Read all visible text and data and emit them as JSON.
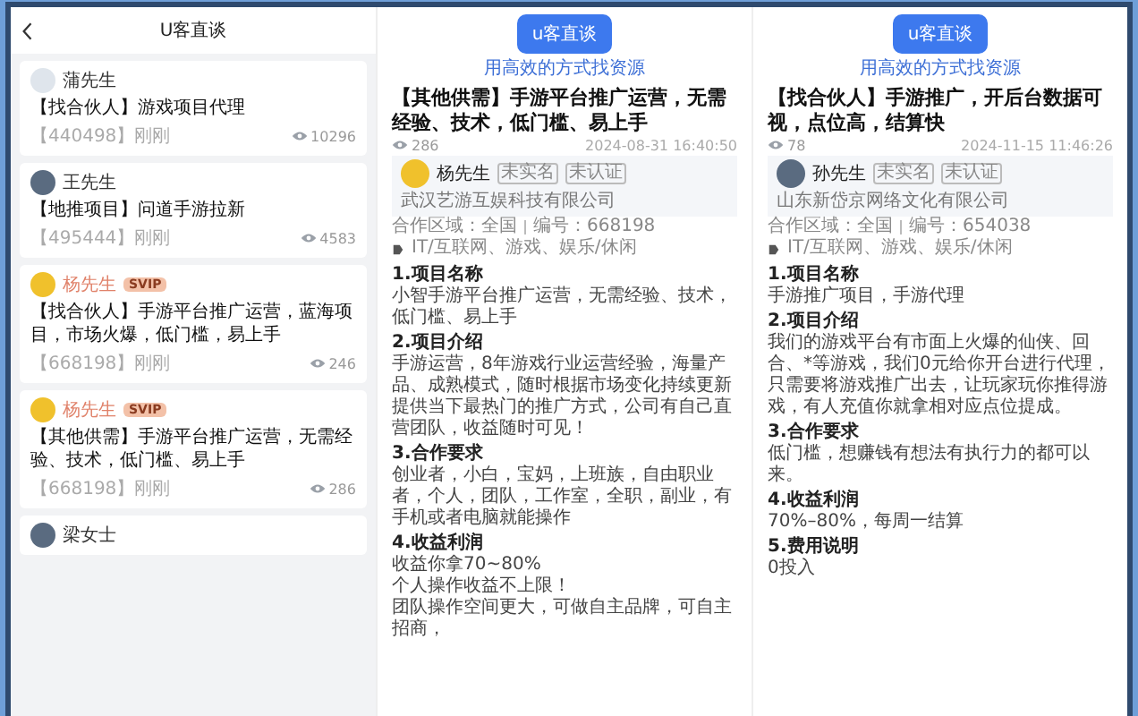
{
  "list_panel": {
    "title": "U客直谈",
    "items": [
      {
        "name": "蒲先生",
        "avatar": {
          "kind": "blank"
        },
        "title": "【找合伙人】游戏项目代理",
        "code": "【440498】刚刚",
        "views": "10296"
      },
      {
        "name": "王先生",
        "avatar": {
          "kind": "photo"
        },
        "title": "【地推项目】问道手游拉新",
        "code": "【495444】刚刚",
        "views": "4583"
      },
      {
        "name": "杨先生",
        "avatar": {
          "kind": "logo"
        },
        "badge": "SVIP",
        "title": "【找合伙人】手游平台推广运营，蓝海项目，市场火爆，低门槛，易上手",
        "code": "【668198】刚刚",
        "views": "246"
      },
      {
        "name": "杨先生",
        "avatar": {
          "kind": "logo"
        },
        "badge": "SVIP",
        "title": "【其他供需】手游平台推广运营，无需经验、技术，低门槛、易上手",
        "code": "【668198】刚刚",
        "views": "286"
      },
      {
        "name": "梁女士",
        "avatar": {
          "kind": "photo"
        }
      }
    ]
  },
  "details": [
    {
      "logo_text": "u客直谈",
      "slogan": "用高效的方式找资源",
      "title": "【其他供需】手游平台推广运营，无需经验、技术，低门槛、易上手",
      "views": "286",
      "date": "2024-08-31 16:40:50",
      "author": {
        "name": "杨先生",
        "avatar": {
          "kind": "logo"
        },
        "badges": [
          "未实名",
          "未认证"
        ],
        "company": "武汉艺游互娱科技有限公司"
      },
      "region": "合作区域：全国",
      "number": "编号：668198",
      "tags": "IT/互联网、游戏、娱乐/休闲",
      "sections": [
        {
          "heading": "1.项目名称",
          "lines": [
            "小智手游平台推广运营，无需经验、技术，低门槛、易上手"
          ]
        },
        {
          "heading": "2.项目介绍",
          "lines": [
            "手游运营，8年游戏行业运营经验，海量产品、成熟模式，随时根据市场变化持续更新提供当下最热门的推广方式，公司有自己直营团队，收益随时可见！"
          ]
        },
        {
          "heading": "3.合作要求",
          "lines": [
            "创业者，小白，宝妈，上班族，自由职业者，个人，团队，工作室，全职，副业，有手机或者电脑就能操作"
          ]
        },
        {
          "heading": "4.收益利润",
          "lines": [
            "收益你拿70~80%",
            "个人操作收益不上限！",
            "团队操作空间更大，可做自主品牌，可自主招商，"
          ]
        }
      ]
    },
    {
      "logo_text": "u客直谈",
      "slogan": "用高效的方式找资源",
      "title": "【找合伙人】手游推广，开后台数据可视，点位高，结算快",
      "views": "78",
      "date": "2024-11-15 11:46:26",
      "author": {
        "name": "孙先生",
        "avatar": {
          "kind": "photo"
        },
        "badges": [
          "未实名",
          "未认证"
        ],
        "company": "山东新岱京网络文化有限公司"
      },
      "region": "合作区域：全国",
      "number": "编号：654038",
      "tags": "IT/互联网、游戏、娱乐/休闲",
      "sections": [
        {
          "heading": "1.项目名称",
          "lines": [
            "手游推广项目，手游代理"
          ]
        },
        {
          "heading": "2.项目介绍",
          "lines": [
            "我们的游戏平台有市面上火爆的仙侠、回合、*等游戏，我们0元给你开台进行代理，只需要将游戏推广出去，让玩家玩你推得游戏，有人充值你就拿相对应点位提成。"
          ]
        },
        {
          "heading": "3.合作要求",
          "lines": [
            "低门槛，想赚钱有想法有执行力的都可以来。"
          ]
        },
        {
          "heading": "4.收益利润",
          "lines": [
            "70%–80%，每周一结算"
          ]
        },
        {
          "heading": "5.费用说明",
          "lines": [
            "0投入"
          ]
        }
      ]
    }
  ]
}
